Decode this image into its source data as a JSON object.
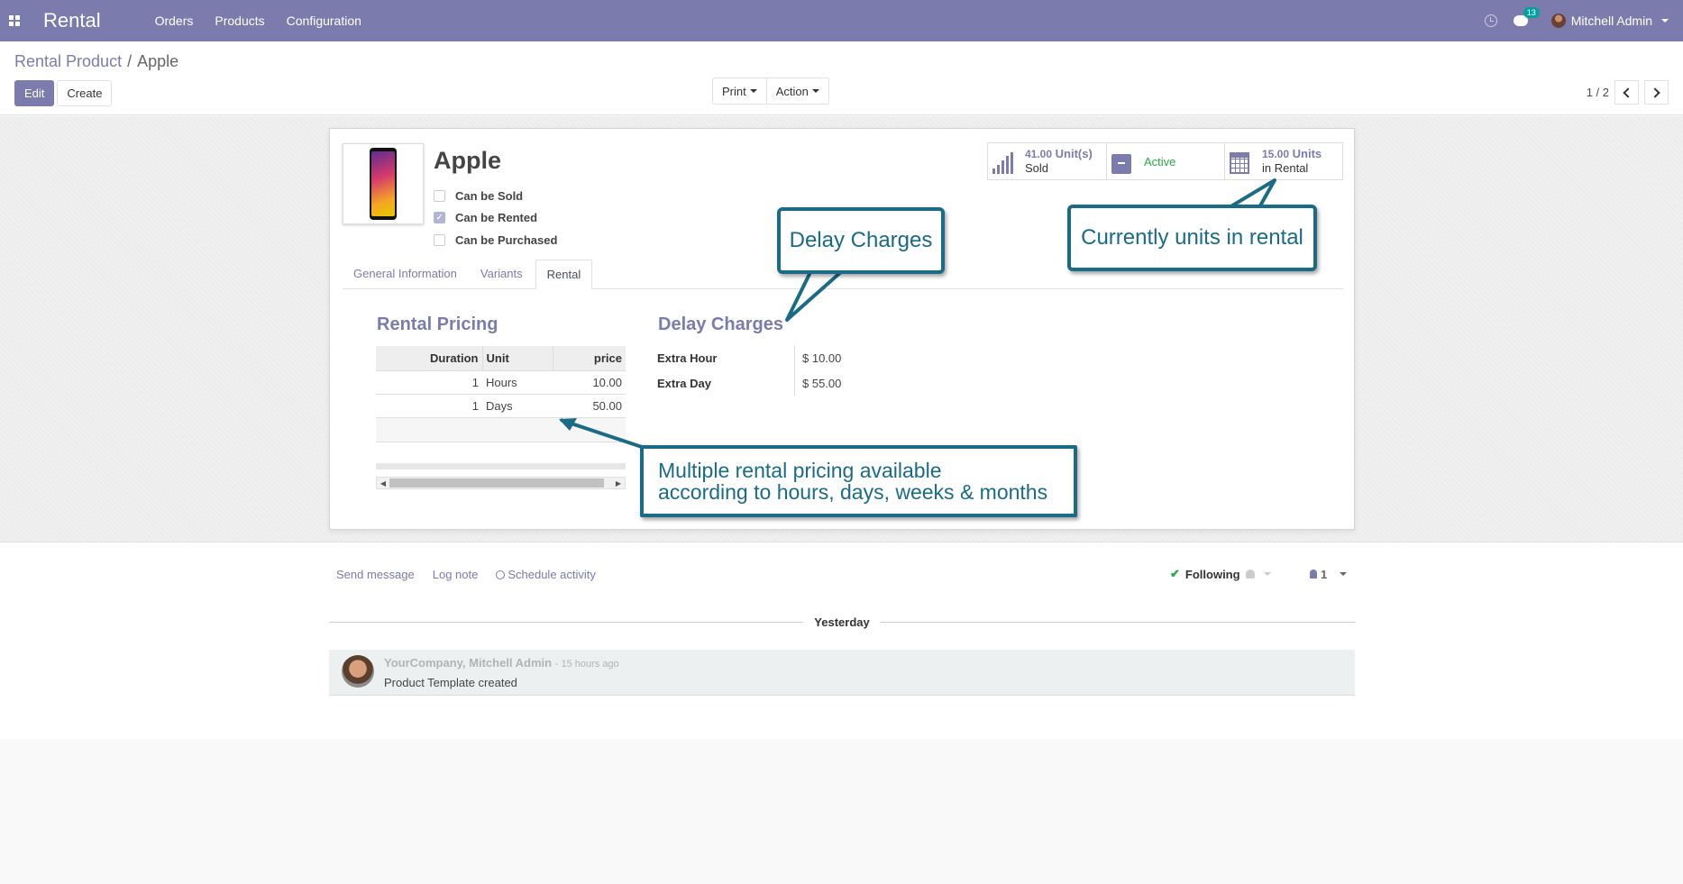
{
  "app": {
    "title": "Rental"
  },
  "nav": {
    "items": [
      "Orders",
      "Products",
      "Configuration"
    ]
  },
  "header": {
    "chat_count": "13",
    "user_name": "Mitchell Admin"
  },
  "breadcrumb": {
    "parent": "Rental Product",
    "separator": "/",
    "current": "Apple"
  },
  "toolbar": {
    "edit_label": "Edit",
    "create_label": "Create",
    "print_label": "Print",
    "action_label": "Action"
  },
  "pager": {
    "value": "1 / 2"
  },
  "product": {
    "name": "Apple",
    "can_be_sold_label": "Can be Sold",
    "can_be_rented_label": "Can be Rented",
    "can_be_purchased_label": "Can be Purchased",
    "can_be_sold": false,
    "can_be_rented": true,
    "can_be_purchased": false
  },
  "stats": {
    "sold_value": "41.00",
    "sold_unit": "Unit(s)",
    "sold_label": "Sold",
    "active_label": "Active",
    "rental_value": "15.00",
    "rental_unit": "Units",
    "rental_label": "in Rental"
  },
  "tabs": [
    "General Information",
    "Variants",
    "Rental"
  ],
  "active_tab": "Rental",
  "pricing": {
    "title": "Rental Pricing",
    "columns": [
      "Duration",
      "Unit",
      "price"
    ],
    "rows": [
      {
        "duration": "1",
        "unit": "Hours",
        "price": "10.00"
      },
      {
        "duration": "1",
        "unit": "Days",
        "price": "50.00"
      }
    ]
  },
  "delay": {
    "title": "Delay Charges",
    "extra_hour_label": "Extra Hour",
    "extra_hour_value": "$ 10.00",
    "extra_day_label": "Extra Day",
    "extra_day_value": "$ 55.00"
  },
  "callouts": {
    "delay_charges": "Delay Charges",
    "units_in_rental": "Currently units in rental",
    "multi_pricing_line1": "Multiple rental pricing available",
    "multi_pricing_line2": "according to hours, days, weeks & months"
  },
  "chatter": {
    "send_message": "Send message",
    "log_note": "Log note",
    "schedule_activity": "Schedule activity",
    "following": "Following",
    "followers_count": "1",
    "date_label": "Yesterday",
    "message_author": "YourCompany, Mitchell Admin",
    "message_time": "- 15 hours ago",
    "message_body": "Product Template created"
  },
  "colors": {
    "brand": "#7c7bad",
    "callout": "#1a6b85",
    "active": "#28a745",
    "badge": "#00a09d"
  },
  "icons": [
    "apps-grid-icon",
    "clock-icon",
    "chat-icon",
    "bar-chart-icon",
    "archive-icon",
    "calendar-icon",
    "check-icon",
    "bell-icon",
    "person-icon"
  ]
}
